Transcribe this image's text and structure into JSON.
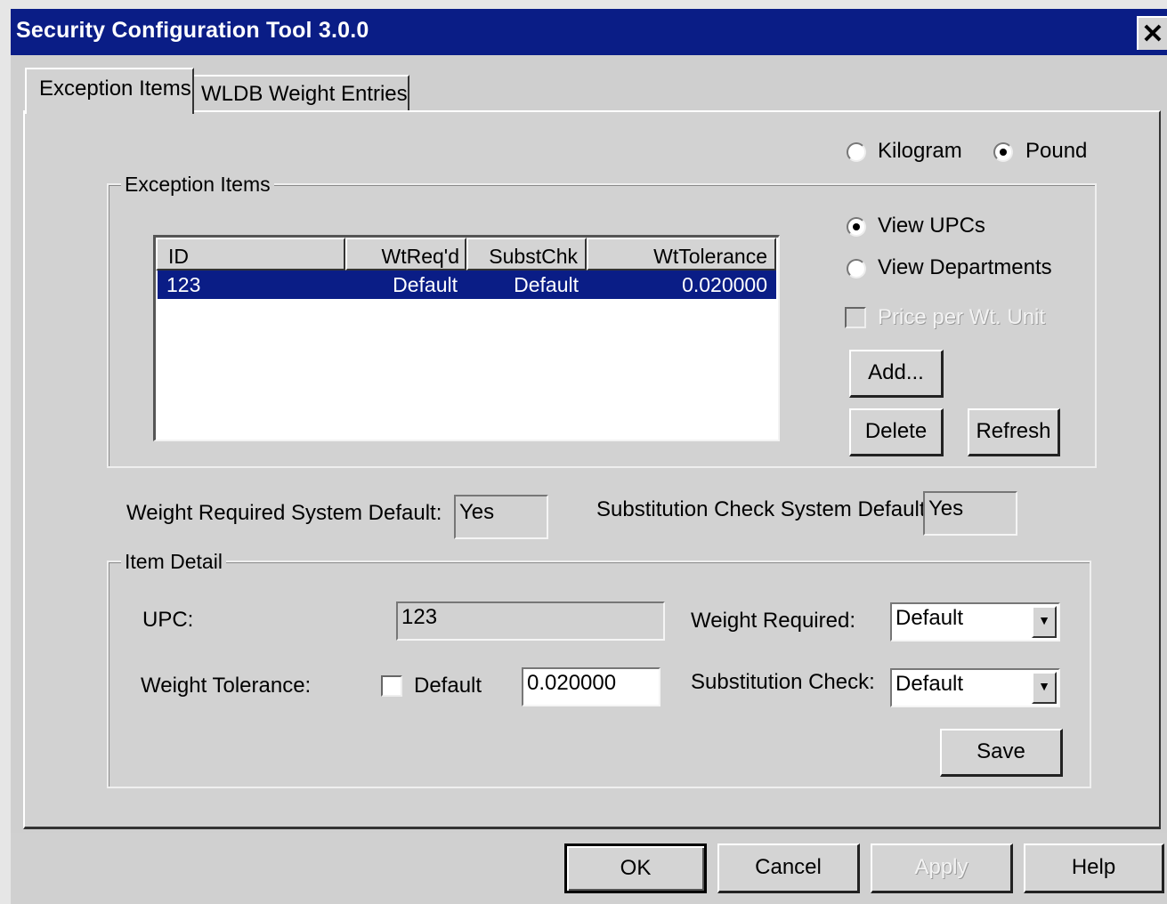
{
  "window": {
    "title": "Security Configuration Tool 3.0.0",
    "close_glyph": "✕"
  },
  "tabs": [
    {
      "label": "Exception Items"
    },
    {
      "label": "WLDB Weight Entries"
    }
  ],
  "units": {
    "kilogram_label": "Kilogram",
    "pound_label": "Pound",
    "selected": "Pound"
  },
  "exception_items": {
    "group_label": "Exception Items",
    "columns": [
      "ID",
      "WtReq'd",
      "SubstChk",
      "WtTolerance"
    ],
    "rows": [
      [
        "123",
        "Default",
        "Default",
        "0.020000"
      ]
    ],
    "view_upcs_label": "View UPCs",
    "view_departments_label": "View Departments",
    "view_selected": "View UPCs",
    "price_per_wt_label": "Price per Wt. Unit",
    "price_per_wt_checked": false,
    "add_label": "Add...",
    "delete_label": "Delete",
    "refresh_label": "Refresh"
  },
  "defaults": {
    "weight_required_label": "Weight Required System Default:",
    "weight_required_value": "Yes",
    "substitution_check_label": "Substitution Check System Default:",
    "substitution_check_value": "Yes"
  },
  "item_detail": {
    "group_label": "Item Detail",
    "upc_label": "UPC:",
    "upc_value": "123",
    "weight_tolerance_label": "Weight Tolerance:",
    "default_label": "Default",
    "default_checked": false,
    "tolerance_value": "0.020000",
    "weight_required_label": "Weight Required:",
    "weight_required_value": "Default",
    "substitution_check_label": "Substitution Check:",
    "substitution_check_value": "Default",
    "save_label": "Save"
  },
  "footer": {
    "ok_label": "OK",
    "cancel_label": "Cancel",
    "apply_label": "Apply",
    "help_label": "Help"
  },
  "colors": {
    "title_bar": "#0a1d86",
    "selection": "#0a1d86",
    "face": "#d2d2d2"
  }
}
